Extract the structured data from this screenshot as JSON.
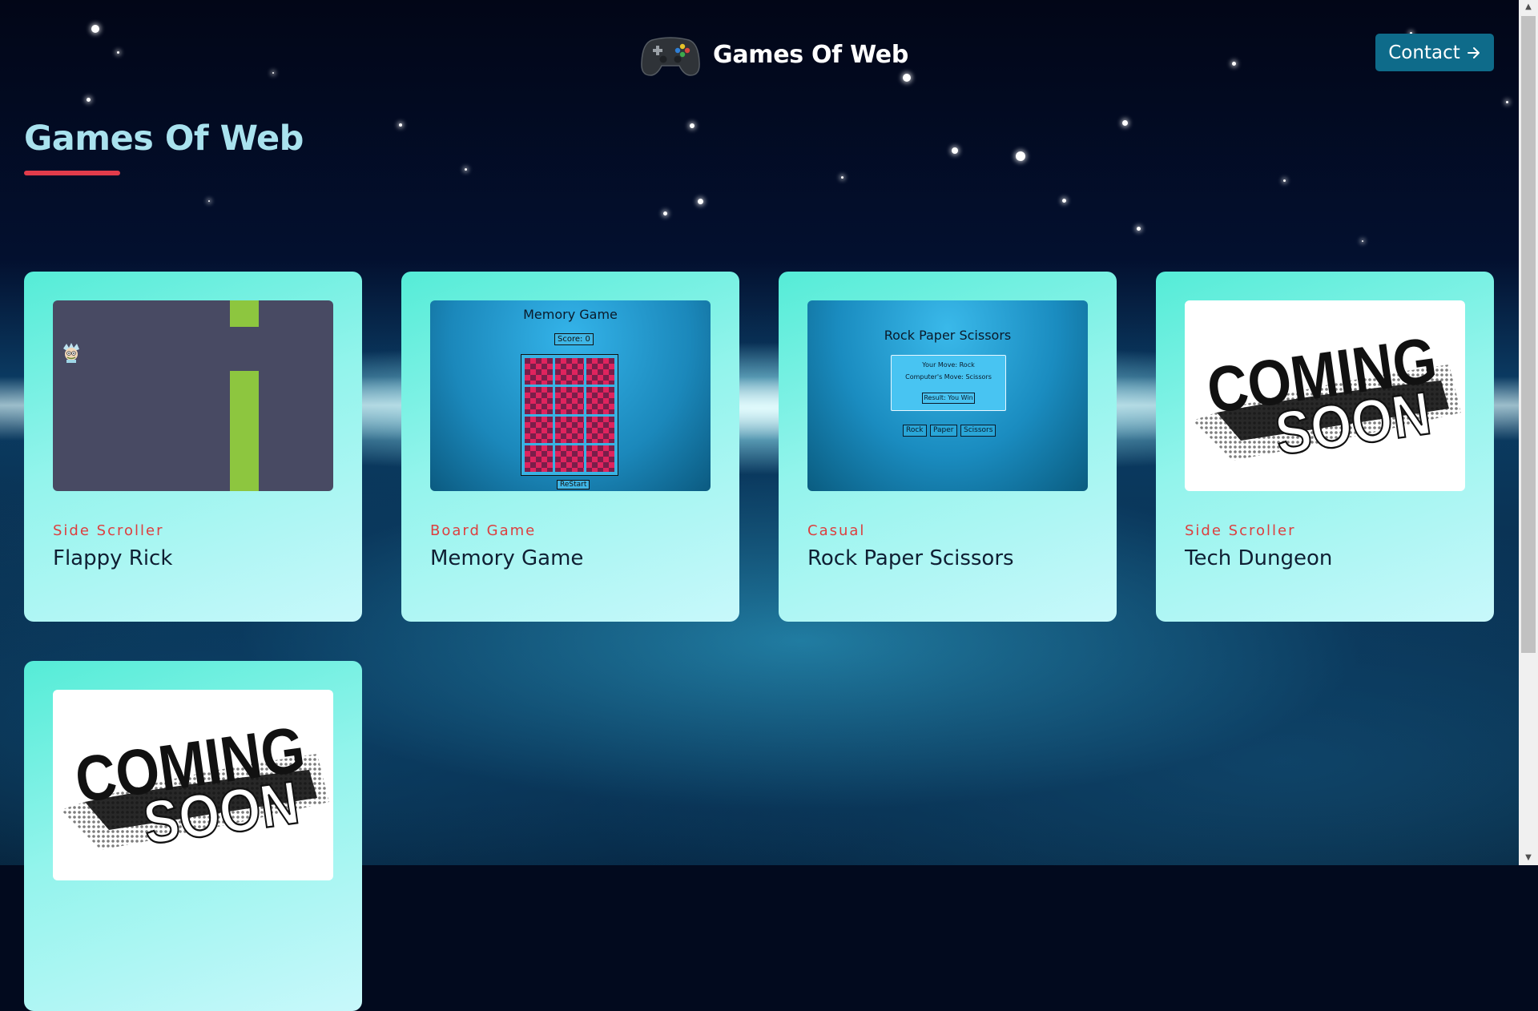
{
  "header": {
    "brand_icon": "gamepad-icon",
    "brand_text": "Games Of Web",
    "contact_label": "Contact",
    "contact_icon": "arrow-right-icon"
  },
  "page": {
    "title": "Games Of Web",
    "accent_color": "#e23c4b"
  },
  "games": [
    {
      "category": "Side Scroller",
      "name": "Flappy Rick"
    },
    {
      "category": "Board Game",
      "name": "Memory Game",
      "preview": {
        "title": "Memory Game",
        "score": "Score: 0",
        "restart": "ReStart"
      }
    },
    {
      "category": "Casual",
      "name": "Rock Paper Scissors",
      "preview": {
        "title": "Rock Paper Scissors",
        "your_move": "Your Move: Rock",
        "computer_move": "Computer's Move: Scissors",
        "result": "Result: You Win",
        "buttons": [
          "Rock",
          "Paper",
          "Scissors"
        ]
      }
    },
    {
      "category": "Side Scroller",
      "name": "Tech Dungeon",
      "preview": {
        "line1": "COMING",
        "line2": "SOON"
      }
    },
    {
      "category": "",
      "name": "",
      "preview": {
        "line1": "COMING",
        "line2": "SOON"
      }
    }
  ]
}
